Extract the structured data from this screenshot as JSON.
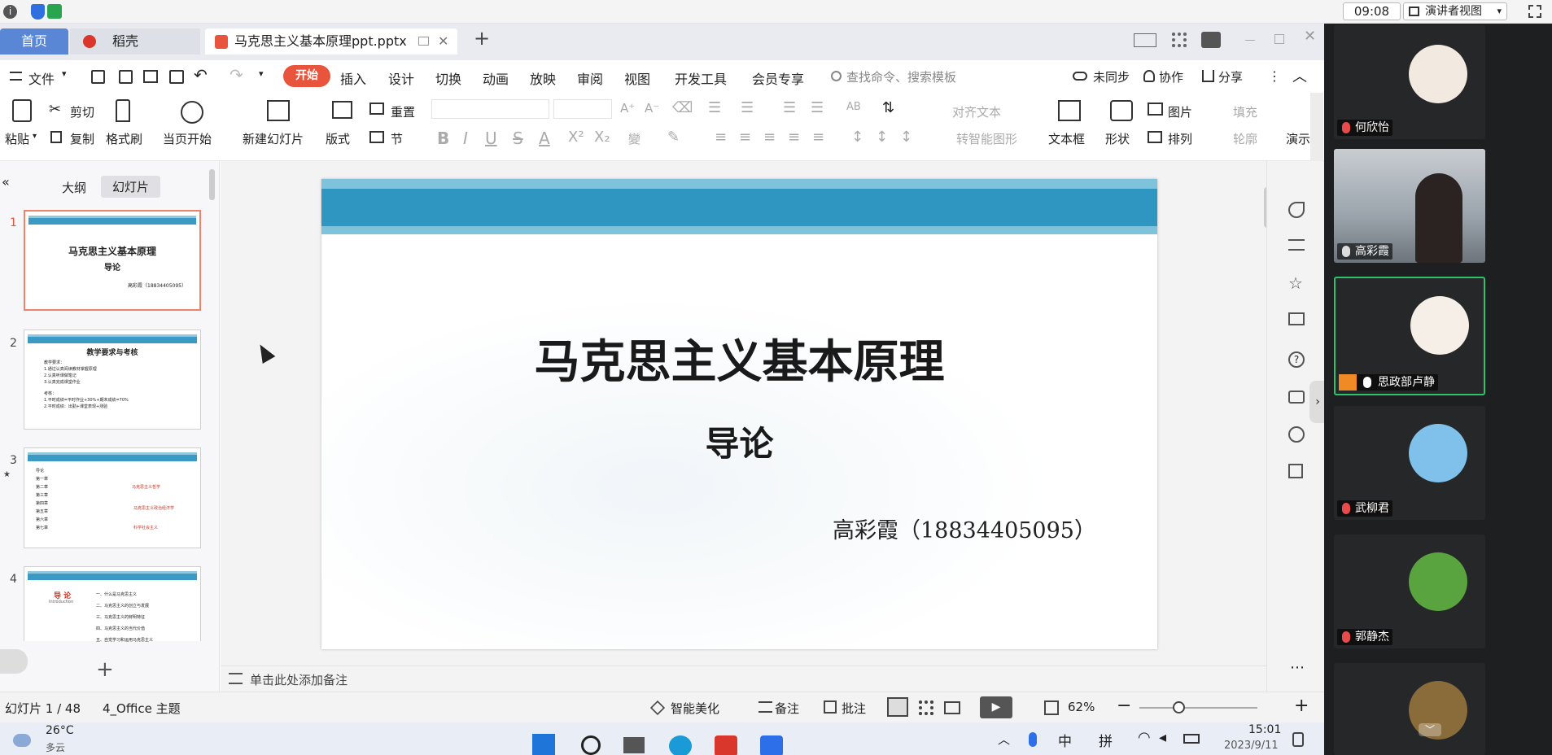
{
  "meeting": {
    "time": "09:08",
    "presenter_view": "演讲者视图"
  },
  "tabs": {
    "home": "首页",
    "daoke": "稻壳",
    "file": "马克思主义基本原理ppt.pptx"
  },
  "menu": {
    "file": "文件",
    "items": [
      "开始",
      "插入",
      "设计",
      "切换",
      "动画",
      "放映",
      "审阅",
      "视图",
      "开发工具",
      "会员专享"
    ],
    "search": "查找命令、搜索模板",
    "sync": "未同步",
    "collab": "协作",
    "share": "分享"
  },
  "toolbar": {
    "paste": "粘贴",
    "cut": "剪切",
    "copy": "复制",
    "format_painter": "格式刷",
    "from_current": "当页开始",
    "new_slide": "新建幻灯片",
    "layout": "版式",
    "reset": "重置",
    "section": "节",
    "align_text": "对齐文本",
    "smart_shape": "转智能图形",
    "textbox": "文本框",
    "shape": "形状",
    "picture": "图片",
    "arrange": "排列",
    "fill": "填充",
    "outline": "轮廓",
    "present": "演示"
  },
  "left": {
    "tab_outline": "大纲",
    "tab_slides": "幻灯片",
    "numbers": [
      "1",
      "2",
      "3",
      "4"
    ],
    "t1": {
      "title": "马克思主义基本原理",
      "sub": "导论",
      "author": "高彩霞（18834405095）"
    },
    "t2": {
      "title": "教学要求与考核",
      "lines": [
        "教学要求：",
        "1.通过认真阅读教材掌握原理",
        "2.认真听课做笔记",
        "3.认真完成课堂作业",
        "考核：",
        "1.平时成绩=平时作业+30%+期末成绩=70%",
        "2.平时成绩：出勤+课堂表现+测验"
      ]
    },
    "t3": {
      "lines": [
        "导论",
        "第一章",
        "第二章",
        "第三章",
        "第四章",
        "第五章",
        "第六章",
        "第七章"
      ],
      "tags": [
        "马克思主义哲学",
        "马克思主义政治经济学",
        "科学社会主义"
      ]
    },
    "t4": {
      "title": "导 论",
      "sub": "Introduction",
      "items": [
        "一、什么是马克思主义",
        "二、马克思主义的创立与发展",
        "三、马克思主义的鲜明特征",
        "四、马克思主义的当代价值",
        "五、自觉学习和运用马克思主义"
      ]
    }
  },
  "slide": {
    "title": "马克思主义基本原理",
    "subtitle": "导论",
    "author": "高彩霞（18834405095）"
  },
  "notes": "单击此处添加备注",
  "status": {
    "slide_pos": "幻灯片 1 / 48",
    "theme": "4_Office 主题",
    "beautify": "智能美化",
    "notes": "备注",
    "comment": "批注",
    "zoom": "62%"
  },
  "taskbar": {
    "temp": "26°C",
    "weather": "多云",
    "clock": "15:01",
    "date": "2023/9/11",
    "ime1": "中",
    "ime2": "拼"
  },
  "participants": [
    "何欣怡",
    "高彩霞",
    "思政部卢静",
    "武柳君",
    "郭静杰"
  ],
  "colors": {
    "accent": "#e8553c",
    "band": "#2e96c1",
    "home_tab": "#5a86d6",
    "speaking": "#2dc26b"
  }
}
